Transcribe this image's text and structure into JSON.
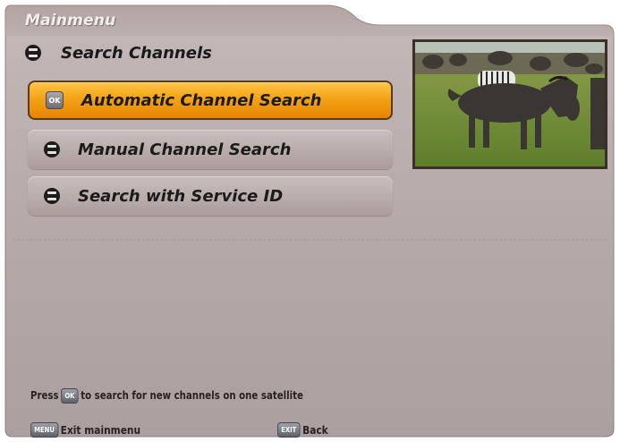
{
  "menu": {
    "title": "Mainmenu",
    "section_label": "Search Channels",
    "items": [
      {
        "label": "Automatic Channel Search",
        "selected": true,
        "icon": "ok-icon",
        "icon_text": "OK"
      },
      {
        "label": "Manual Channel Search",
        "selected": false,
        "icon": "arrow-icon"
      },
      {
        "label": "Search with Service ID",
        "selected": false,
        "icon": "arrow-icon"
      }
    ]
  },
  "hint": {
    "prefix": "Press",
    "key": "OK",
    "suffix": "to search for new channels on one satellite"
  },
  "footer": {
    "menu_key": "MENU",
    "menu_label": "Exit mainmenu",
    "exit_key": "EXIT",
    "exit_label": "Back"
  },
  "colors": {
    "panel": "#b4a9a8",
    "highlight": "#f4a414",
    "text": "#1a1a1a"
  }
}
